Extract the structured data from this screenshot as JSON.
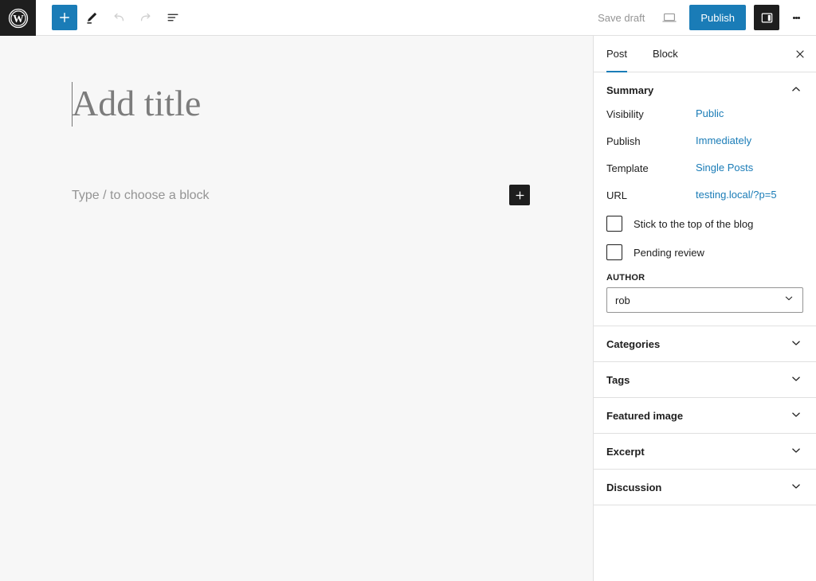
{
  "header": {
    "logo_icon": "wordpress-logo-icon",
    "toolbar_left": [
      {
        "name": "block-inserter-toggle",
        "icon": "plus-icon",
        "label": "Toggle block inserter",
        "state": "active"
      },
      {
        "name": "tools-pen",
        "icon": "pencil-icon",
        "label": "Tools",
        "state": "default"
      },
      {
        "name": "undo",
        "icon": "undo-arrow-icon",
        "label": "Undo",
        "state": "disabled"
      },
      {
        "name": "redo",
        "icon": "redo-arrow-icon",
        "label": "Redo",
        "state": "disabled"
      },
      {
        "name": "document-overview",
        "icon": "list-view-icon",
        "label": "Document Overview",
        "state": "default"
      }
    ],
    "save_draft_label": "Save draft",
    "preview_icon": "laptop-preview-icon",
    "publish_label": "Publish",
    "settings_toggle_icon": "sidebar-panel-icon",
    "more_options_icon": "three-dots-vertical-icon"
  },
  "canvas": {
    "title_placeholder": "Add title",
    "block_placeholder": "Type / to choose a block",
    "inserter_icon": "plus-icon"
  },
  "sidebar": {
    "tabs": [
      {
        "label": "Post",
        "active": true
      },
      {
        "label": "Block",
        "active": false
      }
    ],
    "close_icon": "close-x-icon",
    "summary": {
      "title": "Summary",
      "chevron_icon": "chevron-up-icon",
      "rows": [
        {
          "label": "Visibility",
          "value": "Public"
        },
        {
          "label": "Publish",
          "value": "Immediately"
        },
        {
          "label": "Template",
          "value": "Single Posts"
        },
        {
          "label": "URL",
          "value": "testing.local/?p=5"
        }
      ],
      "checkboxes": [
        {
          "label": "Stick to the top of the blog",
          "checked": false
        },
        {
          "label": "Pending review",
          "checked": false
        }
      ],
      "author_label": "AUTHOR",
      "author_value": "rob",
      "author_arrow_icon": "chevron-down-icon"
    },
    "panels": [
      {
        "label": "Categories",
        "chevron_icon": "chevron-down-icon"
      },
      {
        "label": "Tags",
        "chevron_icon": "chevron-down-icon"
      },
      {
        "label": "Featured image",
        "chevron_icon": "chevron-down-icon"
      },
      {
        "label": "Excerpt",
        "chevron_icon": "chevron-down-icon"
      },
      {
        "label": "Discussion",
        "chevron_icon": "chevron-down-icon"
      }
    ]
  },
  "colors": {
    "accent_blue": "#1a7cb7",
    "link_blue": "#1a7cb7",
    "dark": "#1e1e1e",
    "canvas_bg": "#f7f7f7",
    "border": "#e0e0e0",
    "muted_text": "#949494"
  }
}
